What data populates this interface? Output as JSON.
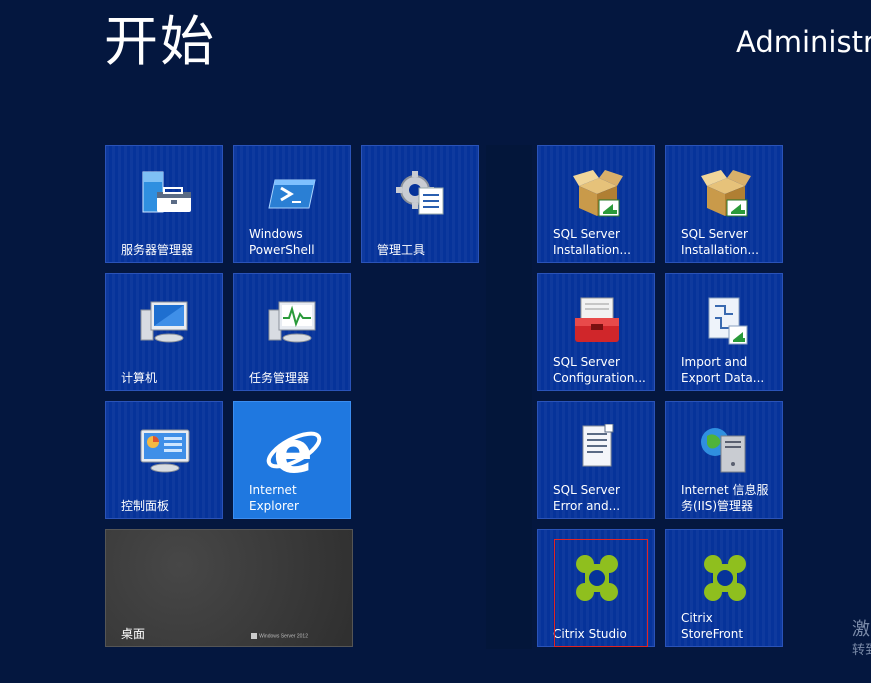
{
  "start_title": "开始",
  "user_name": "Administra",
  "activation": {
    "line1": "激",
    "line2": "转到"
  },
  "desktop_brand": "Windows Server 2012",
  "tiles": {
    "server_manager": {
      "label": "服务器管理器",
      "icon": "server-manager-icon"
    },
    "powershell": {
      "label": "Windows\nPowerShell",
      "icon": "powershell-icon"
    },
    "admin_tools": {
      "label": "管理工具",
      "icon": "admin-tools-icon"
    },
    "computer": {
      "label": "计算机",
      "icon": "computer-icon"
    },
    "task_manager": {
      "label": "任务管理器",
      "icon": "task-manager-icon"
    },
    "control_panel": {
      "label": "控制面板",
      "icon": "control-panel-icon"
    },
    "ie": {
      "label": "Internet\nExplorer",
      "icon": "internet-explorer-icon"
    },
    "desktop": {
      "label": "桌面"
    },
    "sql_install_1": {
      "label": "SQL Server\nInstallation...",
      "icon": "sql-installer-box-icon"
    },
    "sql_install_2": {
      "label": "SQL Server\nInstallation...",
      "icon": "sql-installer-box-icon"
    },
    "sql_config": {
      "label": "SQL Server\nConfiguration...",
      "icon": "toolbox-icon"
    },
    "import_export": {
      "label": "Import and\nExport Data...",
      "icon": "import-export-icon"
    },
    "sql_error": {
      "label": "SQL Server\nError and...",
      "icon": "error-report-icon"
    },
    "iis": {
      "label": "Internet 信息服\n务(IIS)管理器",
      "icon": "iis-manager-icon"
    },
    "citrix_studio": {
      "label": "Citrix Studio",
      "icon": "citrix-logo-icon"
    },
    "citrix_storefront": {
      "label": "Citrix\nStoreFront",
      "icon": "citrix-logo-icon"
    }
  },
  "colors": {
    "background": "#04173f",
    "tile": "#06339a",
    "ie_tile": "#1f78e0",
    "desktop_tile": "#3a3a3a",
    "focus": "#e02424"
  }
}
